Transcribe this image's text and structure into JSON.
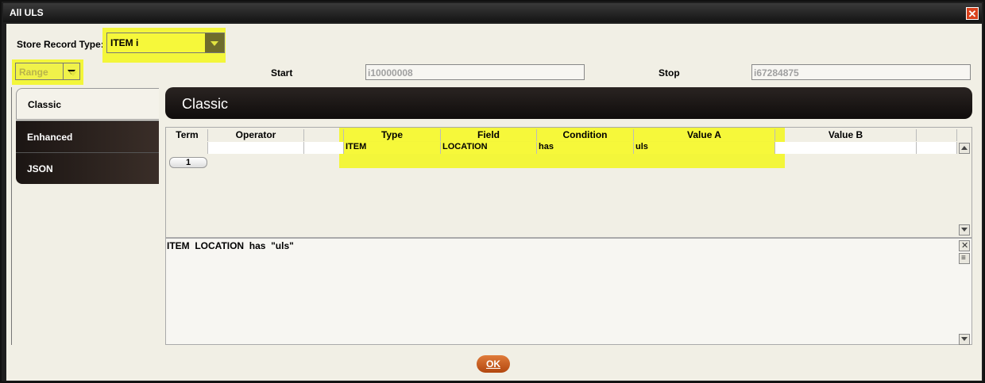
{
  "window": {
    "title": "All ULS"
  },
  "store_record_type": {
    "label": "Store Record Type:",
    "value": "ITEM i"
  },
  "range": {
    "value": "Range"
  },
  "start": {
    "label": "Start",
    "value": "i10000008"
  },
  "stop": {
    "label": "Stop",
    "value": "i67284875"
  },
  "tabs": [
    {
      "label": "Classic"
    },
    {
      "label": "Enhanced"
    },
    {
      "label": "JSON"
    }
  ],
  "banner": {
    "title": "Classic"
  },
  "grid": {
    "headers": [
      "Term",
      "Operator",
      "",
      "Type",
      "Field",
      "Condition",
      "Value A",
      "Value B",
      ""
    ],
    "row": {
      "term": "1",
      "operator": "",
      "blank": "",
      "type": "ITEM",
      "field": "LOCATION",
      "condition": "has",
      "value_a": "uls",
      "value_b": "",
      "extra": ""
    }
  },
  "query_text": "ITEM  LOCATION  has  \"uls\"",
  "ok_label": "OK",
  "colors": {
    "highlight": "#f3f63a",
    "ok_button": "#c95a1f"
  }
}
